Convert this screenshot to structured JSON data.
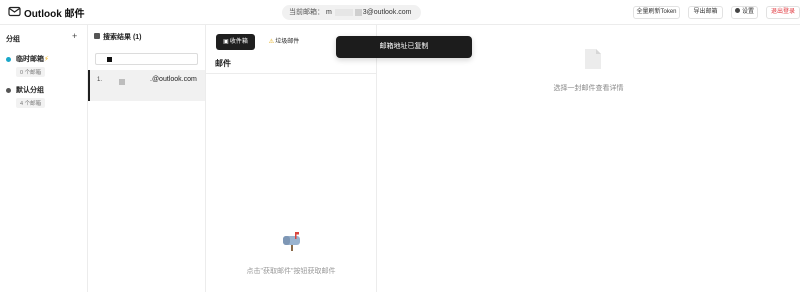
{
  "header": {
    "app_title": "Outlook 邮件",
    "current_email_label": "当前邮箱：",
    "current_email_prefix": "m",
    "current_email_suffix": "3@outlook.com",
    "refresh_all_token_label": "全量刷新Token",
    "export_email_label": "导出邮箱",
    "settings_label": "设置",
    "logout_label": "退出登录"
  },
  "groups": {
    "title": "分组",
    "add_icon": "plus-icon",
    "items": [
      {
        "name": "临时邮箱",
        "count": "0 个邮箱",
        "color": "#1aa7c9",
        "badge_icon": "lightning-icon"
      },
      {
        "name": "默认分组",
        "count": "4 个邮箱",
        "color": "#555555"
      }
    ]
  },
  "results": {
    "title": "搜索结果 (1)",
    "search_value": "",
    "items": [
      {
        "index": "1.",
        "email": ".@outlook.com"
      }
    ]
  },
  "mail": {
    "tabs": [
      {
        "label": "收件箱",
        "icon": "inbox-icon"
      },
      {
        "label": "垃圾邮件",
        "icon": "warning-icon"
      }
    ],
    "title": "邮件",
    "empty_text": "点击\"获取邮件\"按钮获取邮件",
    "empty_icon": "mailbox-icon"
  },
  "detail": {
    "empty_text": "选择一封邮件查看详情",
    "empty_icon": "document-icon"
  },
  "toast": {
    "message": "邮箱地址已复制"
  },
  "colors": {
    "accent_dark": "#1f1f1f",
    "logout_red": "#e0353c",
    "temp_group": "#1aa7c9",
    "warning": "#e0a400"
  }
}
